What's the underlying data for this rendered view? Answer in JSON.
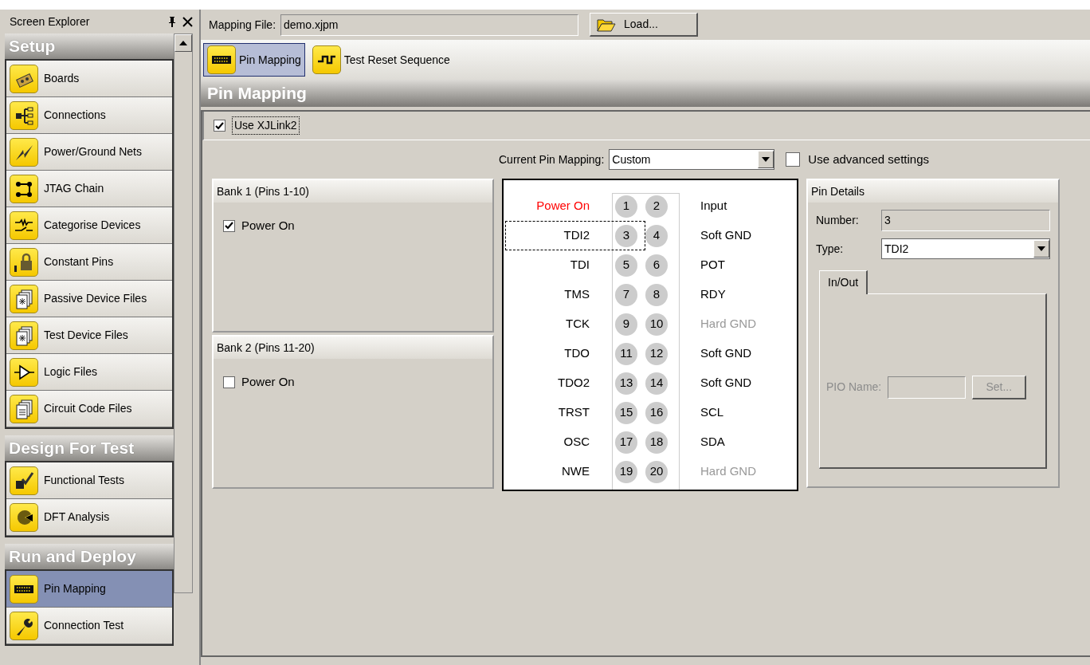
{
  "explorer": {
    "title": "Screen Explorer",
    "sections": [
      {
        "title": "Setup",
        "items": [
          {
            "label": "Boards",
            "selected": false
          },
          {
            "label": "Connections",
            "selected": false
          },
          {
            "label": "Power/Ground Nets",
            "selected": false
          },
          {
            "label": "JTAG Chain",
            "selected": false
          },
          {
            "label": "Categorise Devices",
            "selected": false
          },
          {
            "label": "Constant Pins",
            "selected": false
          },
          {
            "label": "Passive Device Files",
            "selected": false
          },
          {
            "label": "Test Device Files",
            "selected": false
          },
          {
            "label": "Logic Files",
            "selected": false
          },
          {
            "label": "Circuit Code Files",
            "selected": false
          }
        ]
      },
      {
        "title": "Design For Test",
        "items": [
          {
            "label": "Functional Tests",
            "selected": false
          },
          {
            "label": "DFT Analysis",
            "selected": false
          }
        ]
      },
      {
        "title": "Run and Deploy",
        "items": [
          {
            "label": "Pin Mapping",
            "selected": true
          },
          {
            "label": "Connection Test",
            "selected": false
          }
        ]
      }
    ]
  },
  "mapping_file": {
    "label": "Mapping File:",
    "value": "demo.xjpm",
    "button": "Load..."
  },
  "toolbar_tabs": [
    {
      "label": "Pin Mapping",
      "selected": true
    },
    {
      "label": "Test Reset Sequence",
      "selected": false
    }
  ],
  "page_title": "Pin Mapping",
  "use_xjlink": {
    "label": "Use XJLink2",
    "checked": true
  },
  "current_mapping": {
    "label": "Current Pin Mapping:",
    "value": "Custom"
  },
  "advanced": {
    "label": "Use advanced settings",
    "checked": false
  },
  "banks": [
    {
      "title": "Bank 1 (Pins 1-10)",
      "power_label": "Power On",
      "checked": true
    },
    {
      "title": "Bank 2 (Pins 11-20)",
      "power_label": "Power On",
      "checked": false
    }
  ],
  "pins": [
    {
      "left": "Power On",
      "powered": true,
      "a": "1",
      "b": "2",
      "right": "Input",
      "right_disabled": false,
      "selected": false
    },
    {
      "left": "TDI2",
      "powered": false,
      "a": "3",
      "b": "4",
      "right": "Soft GND",
      "right_disabled": false,
      "selected": true
    },
    {
      "left": "TDI",
      "powered": false,
      "a": "5",
      "b": "6",
      "right": "POT",
      "right_disabled": false,
      "selected": false
    },
    {
      "left": "TMS",
      "powered": false,
      "a": "7",
      "b": "8",
      "right": "RDY",
      "right_disabled": false,
      "selected": false
    },
    {
      "left": "TCK",
      "powered": false,
      "a": "9",
      "b": "10",
      "right": "Hard GND",
      "right_disabled": true,
      "selected": false
    },
    {
      "left": "TDO",
      "powered": false,
      "a": "11",
      "b": "12",
      "right": "Soft GND",
      "right_disabled": false,
      "selected": false
    },
    {
      "left": "TDO2",
      "powered": false,
      "a": "13",
      "b": "14",
      "right": "Soft GND",
      "right_disabled": false,
      "selected": false
    },
    {
      "left": "TRST",
      "powered": false,
      "a": "15",
      "b": "16",
      "right": "SCL",
      "right_disabled": false,
      "selected": false
    },
    {
      "left": "OSC",
      "powered": false,
      "a": "17",
      "b": "18",
      "right": "SDA",
      "right_disabled": false,
      "selected": false
    },
    {
      "left": "NWE",
      "powered": false,
      "a": "19",
      "b": "20",
      "right": "Hard GND",
      "right_disabled": true,
      "selected": false
    }
  ],
  "pin_details": {
    "title": "Pin Details",
    "number_label": "Number:",
    "number": "3",
    "type_label": "Type:",
    "type": "TDI2",
    "tab": "In/Out",
    "pio_label": "PIO Name:",
    "set_button": "Set...",
    "disabled": true
  }
}
